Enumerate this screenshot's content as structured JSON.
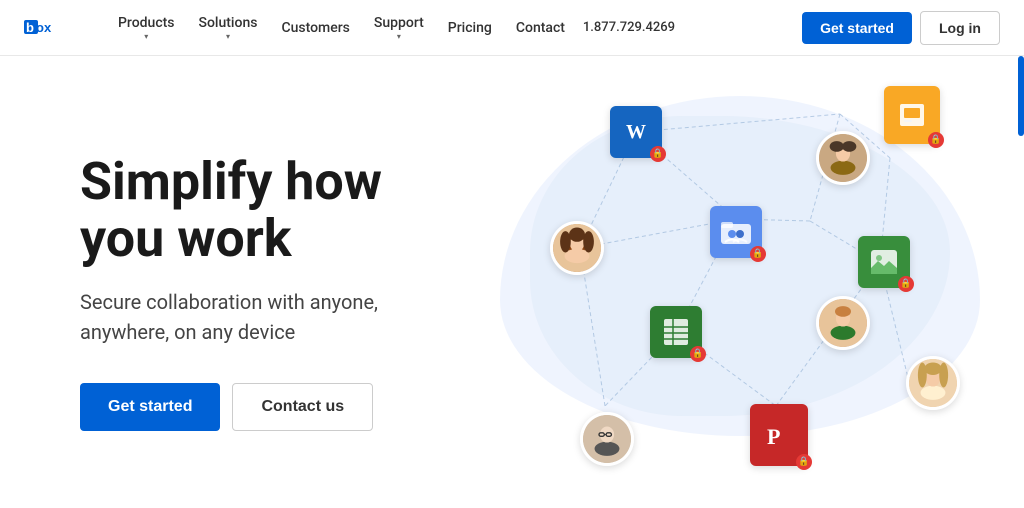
{
  "header": {
    "logo": "box",
    "nav": [
      {
        "label": "Products",
        "has_dropdown": true
      },
      {
        "label": "Solutions",
        "has_dropdown": true
      },
      {
        "label": "Customers",
        "has_dropdown": false
      },
      {
        "label": "Support",
        "has_dropdown": true
      },
      {
        "label": "Pricing",
        "has_dropdown": false
      },
      {
        "label": "Contact",
        "has_dropdown": false
      }
    ],
    "phone": "1.877.729.4269",
    "get_started": "Get started",
    "login": "Log in"
  },
  "hero": {
    "title_line1": "Simplify how",
    "title_line2": "you work",
    "subtitle": "Secure collaboration with anyone, anywhere, on any device",
    "cta_primary": "Get started",
    "cta_secondary": "Contact us"
  },
  "icons": {
    "word_letter": "W",
    "folder_symbol": "👥",
    "sheets_symbol": "⊞",
    "lock": "🔒"
  }
}
